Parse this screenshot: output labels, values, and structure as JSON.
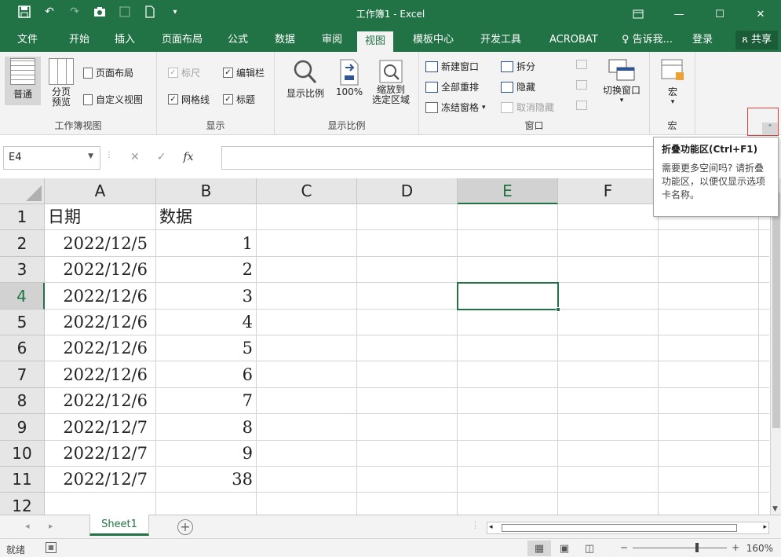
{
  "window": {
    "title": "工作簿1 - Excel"
  },
  "tabs": [
    {
      "label": "文件"
    },
    {
      "label": "开始"
    },
    {
      "label": "插入"
    },
    {
      "label": "页面布局"
    },
    {
      "label": "公式"
    },
    {
      "label": "数据"
    },
    {
      "label": "审阅"
    },
    {
      "label": "视图"
    },
    {
      "label": "模板中心"
    },
    {
      "label": "开发工具"
    },
    {
      "label": "ACROBAT"
    }
  ],
  "tell_me": "告诉我...",
  "login": "登录",
  "share": "共享",
  "ribbon": {
    "workbook_views": {
      "normal": "普通",
      "page_break": "分页\n预览",
      "page_layout": "页面布局",
      "custom_views": "自定义视图",
      "label": "工作簿视图"
    },
    "show": {
      "ruler": "标尺",
      "formula_bar": "编辑栏",
      "gridlines": "网格线",
      "headings": "标题",
      "label": "显示"
    },
    "zoom": {
      "zoom": "显示比例",
      "hundred": "100%",
      "to_selection": "缩放到\n选定区域",
      "label": "显示比例"
    },
    "window": {
      "new_window": "新建窗口",
      "arrange_all": "全部重排",
      "freeze": "冻结窗格",
      "split": "拆分",
      "hide": "隐藏",
      "unhide": "取消隐藏",
      "switch": "切换窗口",
      "label": "窗口"
    },
    "macros": {
      "macros": "宏",
      "label": "宏"
    }
  },
  "tooltip": {
    "title": "折叠功能区(Ctrl+F1)",
    "body": "需要更多空间吗? 请折叠功能区，以便仅显示选项卡名称。"
  },
  "formula_bar": {
    "name_box": "E4",
    "value": ""
  },
  "columns": [
    "A",
    "B",
    "C",
    "D",
    "E",
    "F"
  ],
  "rows": [
    {
      "num": "1",
      "a": "日期",
      "b": ""
    },
    {
      "num": "2",
      "a": "2022/12/5",
      "b": "1"
    },
    {
      "num": "3",
      "a": "2022/12/6",
      "b": "2"
    },
    {
      "num": "4",
      "a": "2022/12/6",
      "b": "3"
    },
    {
      "num": "5",
      "a": "2022/12/6",
      "b": "4"
    },
    {
      "num": "6",
      "a": "2022/12/6",
      "b": "5"
    },
    {
      "num": "7",
      "a": "2022/12/6",
      "b": "6"
    },
    {
      "num": "8",
      "a": "2022/12/6",
      "b": "7"
    },
    {
      "num": "9",
      "a": "2022/12/7",
      "b": "8"
    },
    {
      "num": "10",
      "a": "2022/12/7",
      "b": "9"
    },
    {
      "num": "11",
      "a": "2022/12/7",
      "b": "38"
    },
    {
      "num": "12",
      "a": "",
      "b": ""
    }
  ],
  "header_b": "数据",
  "active_cell": "E4",
  "sheets": [
    {
      "label": "Sheet1"
    }
  ],
  "status": {
    "ready": "就绪",
    "zoom": "160%"
  },
  "colors": {
    "accent": "#217346"
  }
}
